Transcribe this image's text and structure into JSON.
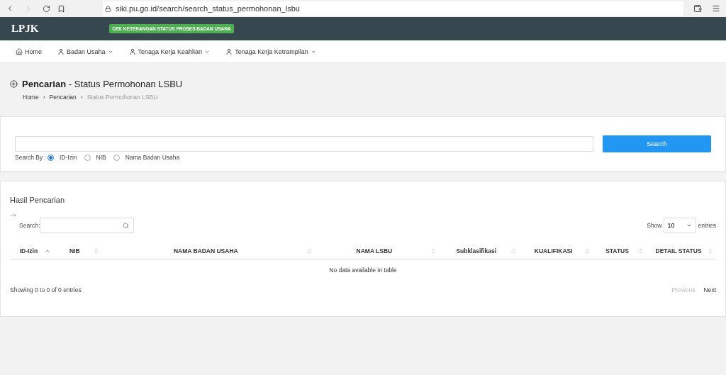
{
  "browser": {
    "url": "siki.pu.go.id/search/search_status_permohonan_lsbu"
  },
  "header": {
    "logo": "LPJK",
    "badge": "CEK KETERANGAN STATUS PROSES BADAN USAHA"
  },
  "nav": [
    {
      "label": "Home",
      "kind": "home",
      "dropdown": false
    },
    {
      "label": "Badan Usaha",
      "kind": "menu",
      "dropdown": true
    },
    {
      "label": "Tenaga Kerja Keahlian",
      "kind": "menu",
      "dropdown": true
    },
    {
      "label": "Tenaga Kerja Ketrampilan",
      "kind": "menu",
      "dropdown": true
    }
  ],
  "page_title": {
    "bold": "Pencarian",
    "rest": "- Status Permohonan LSBU"
  },
  "breadcrumb": [
    {
      "label": "Home",
      "current": false
    },
    {
      "separator": "›",
      "label": "Pencarian",
      "current": false
    },
    {
      "separator": "›",
      "label": "Status Permohonan LSBU",
      "current": true
    }
  ],
  "search": {
    "button": "Search",
    "search_by_label": "Search By :",
    "options": [
      {
        "label": "ID-Izin",
        "selected": true
      },
      {
        "label": "NIB",
        "selected": false
      },
      {
        "label": "Nama Badan Usaha",
        "selected": false
      }
    ]
  },
  "results": {
    "title": "Hasil Pencarian",
    "stray_text": "-->",
    "filter_label": "Search:",
    "show_label": "Show",
    "page_size": "10",
    "entries_label": "entries",
    "columns": [
      {
        "label": "ID-Izin",
        "sorted": true
      },
      {
        "label": "NIB",
        "sorted": false
      },
      {
        "label": "NAMA BADAN USAHA",
        "sorted": false
      },
      {
        "label": "NAMA LSBU",
        "sorted": false
      },
      {
        "label": "Subklasifikasi",
        "sorted": false
      },
      {
        "label": "KUALIFIKASI",
        "sorted": false
      },
      {
        "label": "STATUS",
        "sorted": false
      },
      {
        "label": "DETAIL STATUS",
        "sorted": false
      }
    ],
    "empty": "No data available in table",
    "info": "Showing 0 to 0 of 0 entries",
    "previous": {
      "label": "Previous",
      "disabled": true
    },
    "next": {
      "label": "Next",
      "disabled": false
    }
  }
}
